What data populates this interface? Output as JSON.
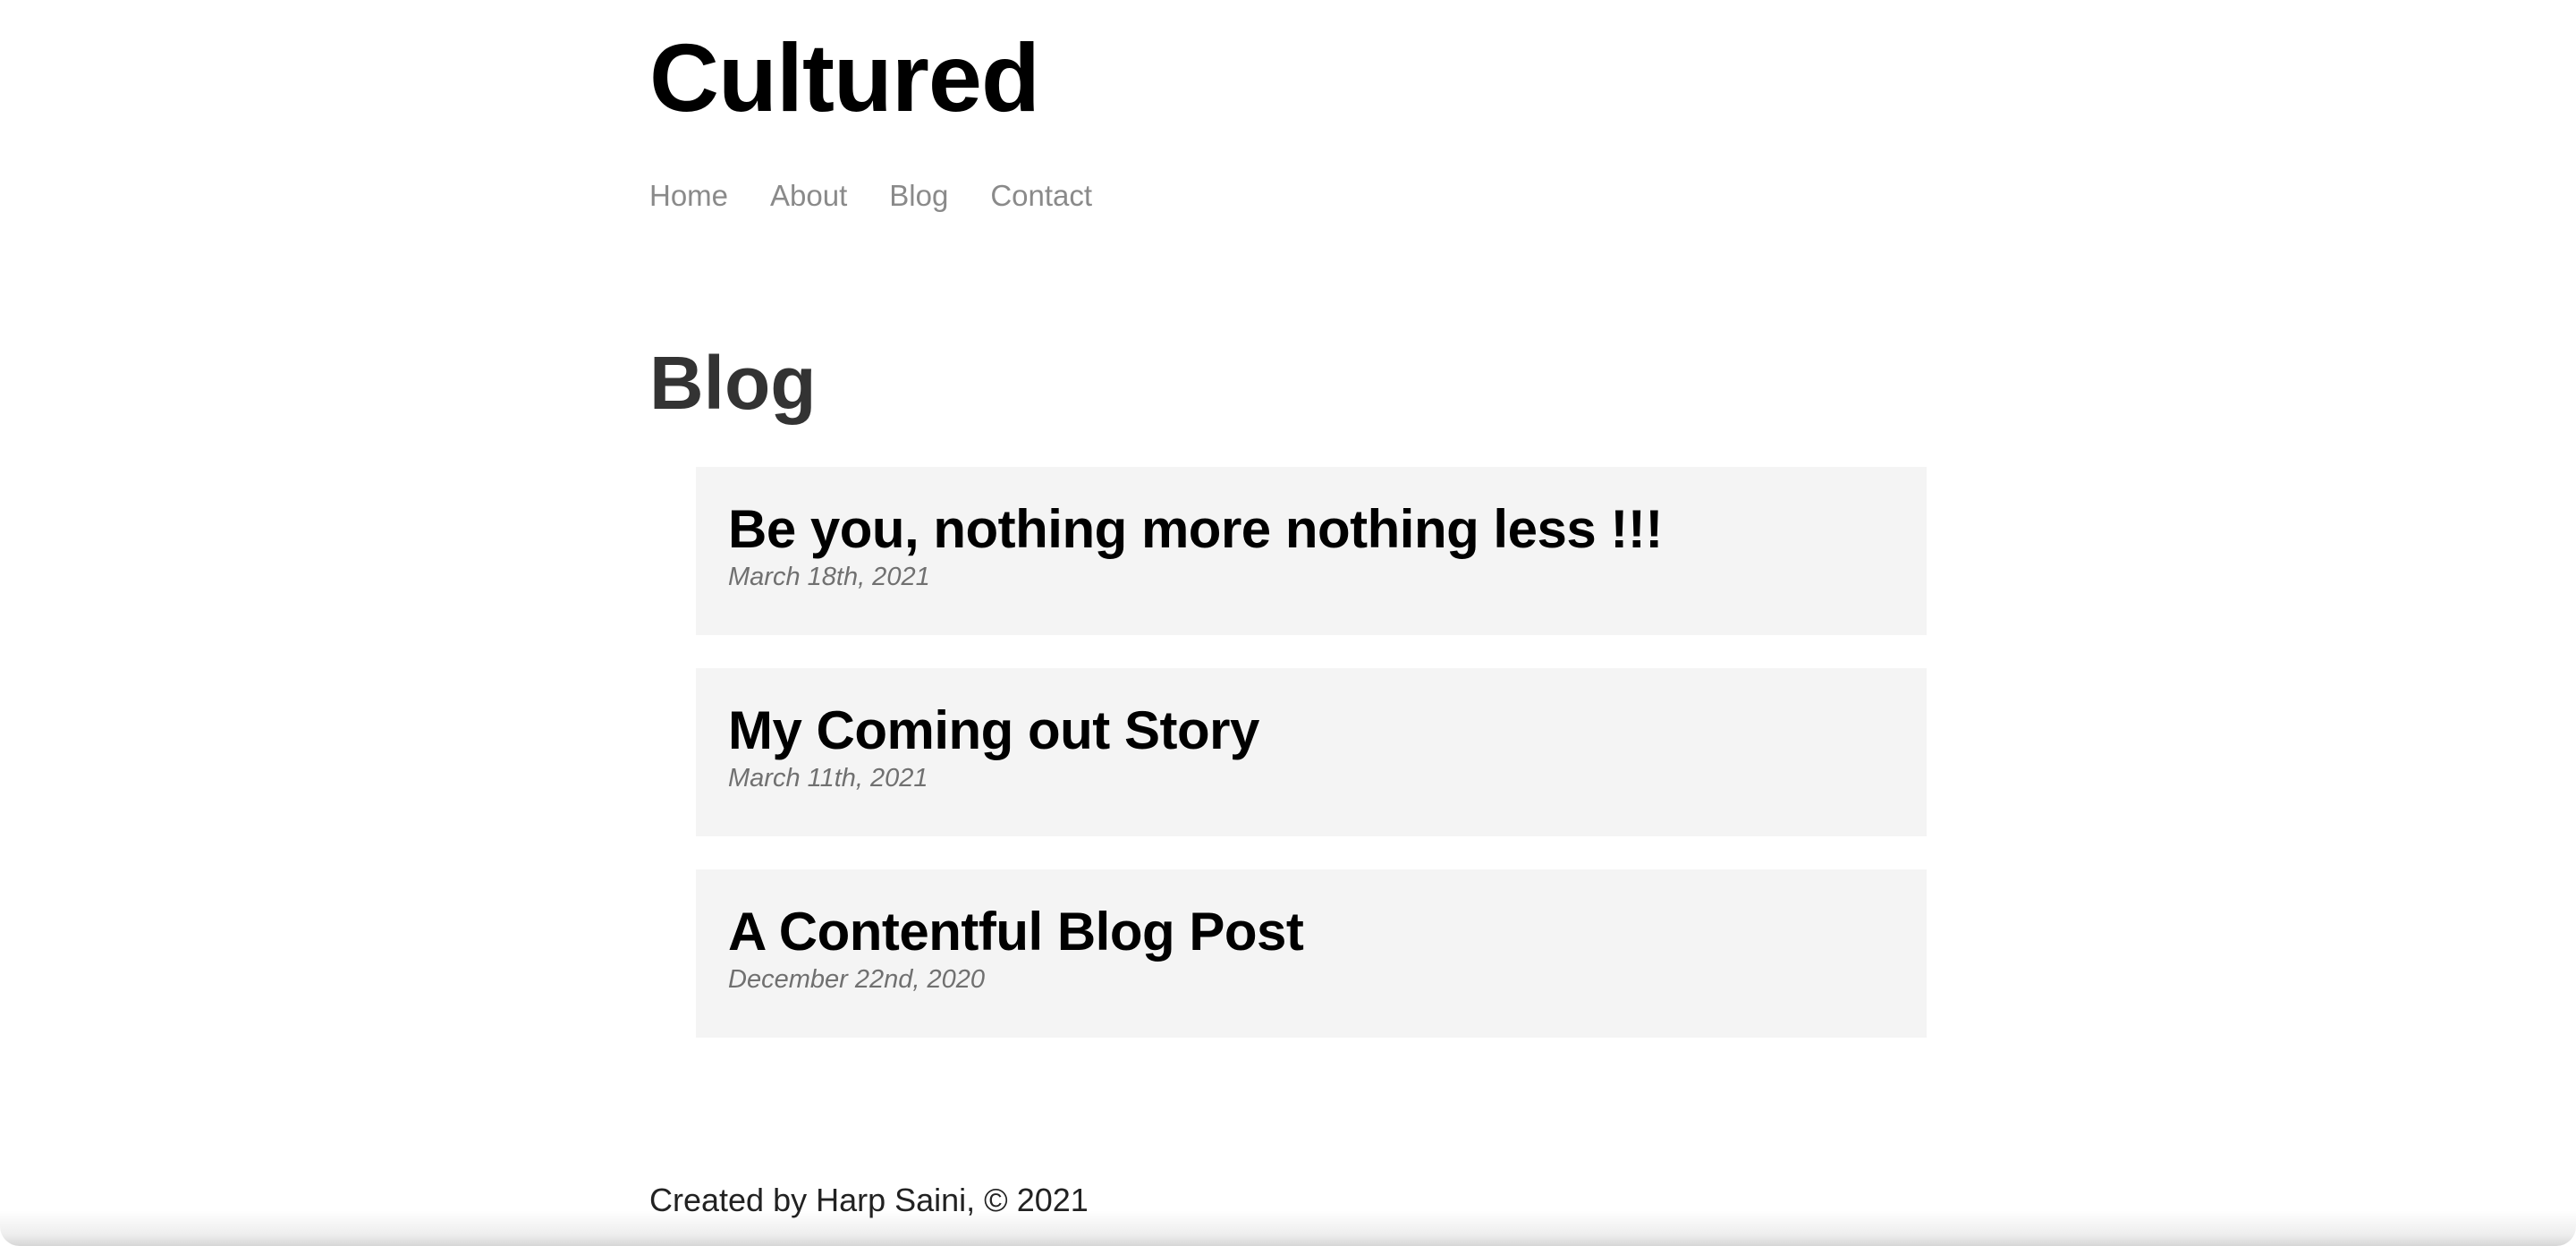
{
  "site": {
    "title": "Cultured"
  },
  "nav": {
    "items": [
      {
        "label": "Home"
      },
      {
        "label": "About"
      },
      {
        "label": "Blog"
      },
      {
        "label": "Contact"
      }
    ]
  },
  "page": {
    "heading": "Blog"
  },
  "posts": [
    {
      "title": "Be you, nothing more nothing less !!!",
      "date": "March 18th, 2021"
    },
    {
      "title": "My Coming out Story",
      "date": "March 11th, 2021"
    },
    {
      "title": "A Contentful Blog Post",
      "date": "December 22nd, 2020"
    }
  ],
  "footer": {
    "text": "Created by Harp Saini, © 2021"
  },
  "colors": {
    "nav_link": "#8a8a8a",
    "card_background": "#f4f4f4",
    "heading": "#333333",
    "date": "#707070"
  }
}
